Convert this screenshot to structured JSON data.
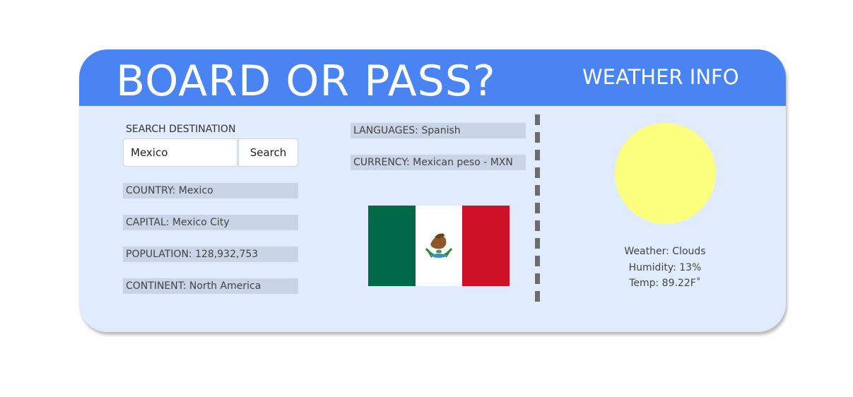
{
  "header": {
    "title": "BOARD OR PASS?",
    "weather_title": "WEATHER INFO"
  },
  "search": {
    "label": "SEARCH DESTINATION",
    "value": "Mexico",
    "button_label": "Search"
  },
  "country_info": {
    "country": "COUNTRY: Mexico",
    "capital": "CAPITAL: Mexico City",
    "population": "POPULATION: 128,932,753",
    "continent": "CONTINENT: North America",
    "languages": "LANGUAGES: Spanish",
    "currency": "CURRENCY: Mexican peso - MXN"
  },
  "flag": {
    "icon": "mexico-flag",
    "colors": [
      "#006847",
      "#ffffff",
      "#ce1126"
    ]
  },
  "weather": {
    "icon": "sun-icon",
    "sun_color": "#fcff7e",
    "conditions": "Weather: Clouds",
    "humidity": "Humidity: 13%",
    "temp": "Temp: 89.22F˚"
  },
  "colors": {
    "header": "#4a84f2",
    "ticket": "#e0ebfd",
    "row": "#c9d4e6",
    "divider": "#6b6b6b"
  }
}
